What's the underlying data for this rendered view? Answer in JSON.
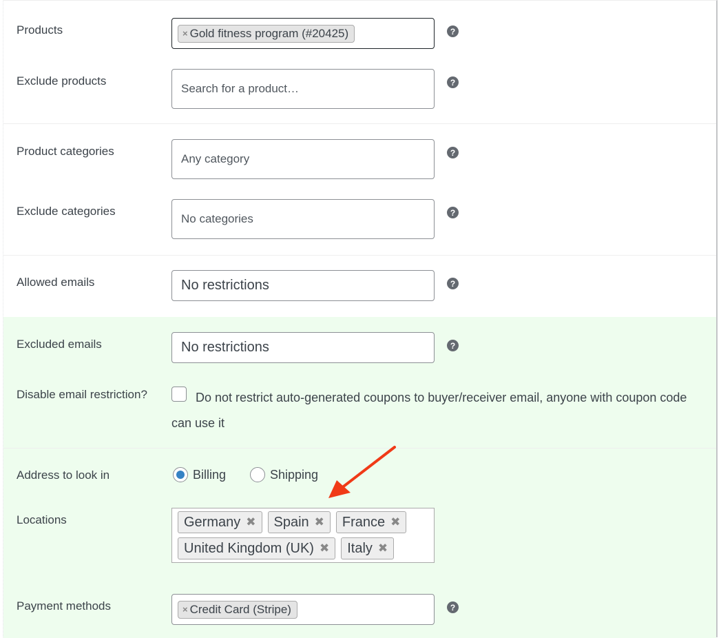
{
  "fields": {
    "products": {
      "label": "Products",
      "chips": [
        "Gold fitness program (#20425)"
      ],
      "remove_symbol": "×",
      "help": "?"
    },
    "exclude_products": {
      "label": "Exclude products",
      "placeholder": "Search for a product…",
      "help": "?"
    },
    "product_categories": {
      "label": "Product categories",
      "placeholder": "Any category",
      "help": "?"
    },
    "exclude_categories": {
      "label": "Exclude categories",
      "placeholder": "No categories",
      "help": "?"
    },
    "allowed_emails": {
      "label": "Allowed emails",
      "placeholder": "No restrictions",
      "help": "?"
    },
    "excluded_emails": {
      "label": "Excluded emails",
      "placeholder": "No restrictions",
      "help": "?"
    },
    "disable_email_restriction": {
      "label": "Disable email restriction?",
      "checked": false,
      "description": "Do not restrict auto-generated coupons to buyer/receiver email, anyone with coupon code can use it"
    },
    "address_to_look_in": {
      "label": "Address to look in",
      "options": [
        "Billing",
        "Shipping"
      ],
      "selected": "Billing"
    },
    "locations": {
      "label": "Locations",
      "chips_row1": [
        "Germany",
        "Spain",
        "France"
      ],
      "chips_row2": [
        "United Kingdom (UK)",
        "Italy"
      ],
      "remove_symbol": "✖"
    },
    "payment_methods": {
      "label": "Payment methods",
      "chips": [
        "Credit Card (Stripe)"
      ],
      "remove_symbol": "×",
      "help": "?"
    }
  },
  "colors": {
    "highlight_bg": "#eefdee",
    "annotation_arrow": "#f03a17",
    "radio_accent": "#3582c4"
  }
}
